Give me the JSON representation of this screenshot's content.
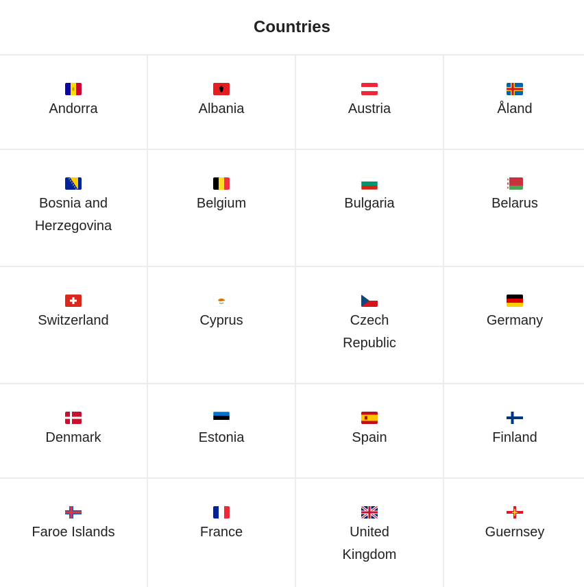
{
  "header": {
    "title": "Countries"
  },
  "countries": [
    {
      "name": "Andorra",
      "flag": "andorra-flag-icon"
    },
    {
      "name": "Albania",
      "flag": "albania-flag-icon"
    },
    {
      "name": "Austria",
      "flag": "austria-flag-icon"
    },
    {
      "name": "Åland",
      "flag": "aland-flag-icon"
    },
    {
      "name": "Bosnia and Herzegovina",
      "flag": "bosnia-flag-icon"
    },
    {
      "name": "Belgium",
      "flag": "belgium-flag-icon"
    },
    {
      "name": "Bulgaria",
      "flag": "bulgaria-flag-icon"
    },
    {
      "name": "Belarus",
      "flag": "belarus-flag-icon"
    },
    {
      "name": "Switzerland",
      "flag": "switzerland-flag-icon"
    },
    {
      "name": "Cyprus",
      "flag": "cyprus-flag-icon"
    },
    {
      "name": "Czech Republic",
      "flag": "czech-flag-icon"
    },
    {
      "name": "Germany",
      "flag": "germany-flag-icon"
    },
    {
      "name": "Denmark",
      "flag": "denmark-flag-icon"
    },
    {
      "name": "Estonia",
      "flag": "estonia-flag-icon"
    },
    {
      "name": "Spain",
      "flag": "spain-flag-icon"
    },
    {
      "name": "Finland",
      "flag": "finland-flag-icon"
    },
    {
      "name": "Faroe Islands",
      "flag": "faroe-flag-icon"
    },
    {
      "name": "France",
      "flag": "france-flag-icon"
    },
    {
      "name": "United Kingdom",
      "flag": "uk-flag-icon"
    },
    {
      "name": "Guernsey",
      "flag": "guernsey-flag-icon"
    }
  ]
}
